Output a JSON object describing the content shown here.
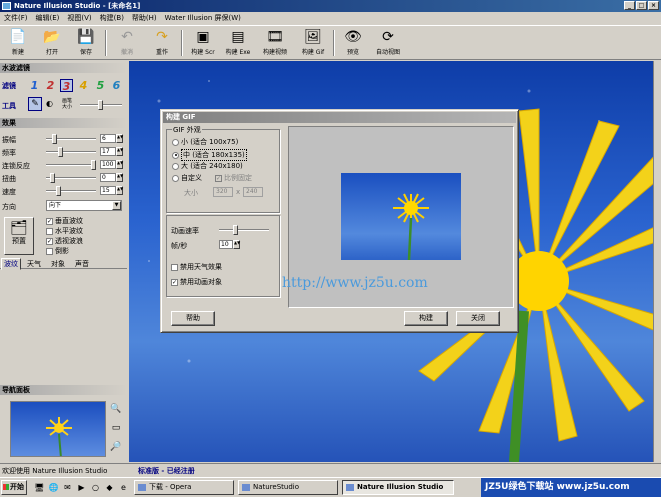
{
  "window": {
    "title": "Nature Illusion Studio - [未命名1]"
  },
  "menu": [
    "文件(F)",
    "编辑(E)",
    "视图(V)",
    "构建(B)",
    "帮助(H)",
    "Water Illusion 屏保(W)"
  ],
  "toolbar": {
    "new": "新建",
    "open": "打开",
    "save": "保存",
    "undo": "撤消",
    "redo": "重作",
    "build_scr": "构建 Scr",
    "build_exe": "构建 Exe",
    "build_video": "构建视频",
    "build_gif": "构建 Gif",
    "preview": "预览",
    "auto_view": "自动视图"
  },
  "left": {
    "water_filter": "水波滤镜",
    "filter": "滤镜",
    "filter_numbers": [
      "1",
      "2",
      "3",
      "4",
      "5",
      "6"
    ],
    "tool": "工具",
    "brush_size": "画笔大小",
    "effects": "效果",
    "params": [
      {
        "label": "振幅",
        "value": "6"
      },
      {
        "label": "频率",
        "value": "17"
      },
      {
        "label": "连锁反应",
        "value": "100"
      },
      {
        "label": "扭曲",
        "value": "0"
      },
      {
        "label": "速度",
        "value": "15"
      }
    ],
    "direction": "方向",
    "direction_value": "向下",
    "checks": [
      {
        "label": "垂直波纹",
        "checked": true
      },
      {
        "label": "水平波纹",
        "checked": false
      },
      {
        "label": "透视波浪",
        "checked": true
      },
      {
        "label": "倒影",
        "checked": false
      }
    ],
    "preset": "预置",
    "tabs": [
      "波纹",
      "天气",
      "对象",
      "声音"
    ],
    "nav_panel": "导航面板"
  },
  "dialog": {
    "title": "构建 GIF",
    "group_size": "GIF 外观",
    "sizes": [
      {
        "label": "小 (适合 100x75)",
        "selected": false
      },
      {
        "label": "中 (适合 180x135)",
        "selected": true
      },
      {
        "label": "大 (适合 240x180)",
        "selected": false
      },
      {
        "label": "自定义",
        "selected": false
      }
    ],
    "keep_ratio": "比例固定",
    "size_label": "大小",
    "width": "320",
    "x": "x",
    "height": "240",
    "anim_speed": "动画速率",
    "fps_label": "帧/秒",
    "fps": "10",
    "disable_weather": "禁用天气效果",
    "disable_weather_checked": false,
    "enable_anim_obj": "禁用动画对象",
    "enable_anim_obj_checked": true,
    "help": "帮助",
    "build": "构建",
    "close": "关闭"
  },
  "watermark": "http://www.jz5u.com",
  "status": {
    "left": "欢迎使用 Nature Illusion Studio",
    "right": "标准版 - 已经注册"
  },
  "taskbar": {
    "start": "开始",
    "tasks": [
      "下载 - Opera",
      "NatureStudio",
      "Nature Illusion Studio"
    ],
    "tray": "JZ5U绿色下载站 www.jz5u.com"
  }
}
